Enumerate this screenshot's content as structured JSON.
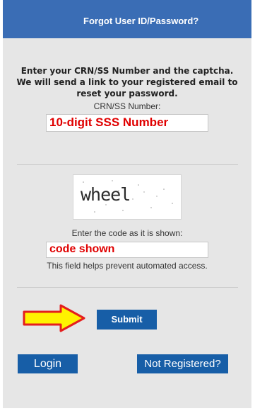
{
  "header": {
    "title": "Forgot User ID/Password?",
    "background": "#3a6db5"
  },
  "instructions": {
    "line1": "Enter your CRN/SS Number and the captcha.",
    "line2": "We will send a link to your registered email to",
    "line3": "reset your password."
  },
  "crn": {
    "label": "CRN/SS Number:",
    "value": "10-digit SSS Number"
  },
  "captcha": {
    "word": "wheel",
    "label": "Enter the code as it is shown:",
    "input_value": "code shown",
    "help": "This field helps prevent automated access."
  },
  "buttons": {
    "submit": "Submit",
    "login": "Login",
    "register": "Not Registered?",
    "color": "#175ea7"
  },
  "annotation": {
    "arrow_icon": "yellow-arrow-right",
    "overlay_color": "#e00000"
  }
}
